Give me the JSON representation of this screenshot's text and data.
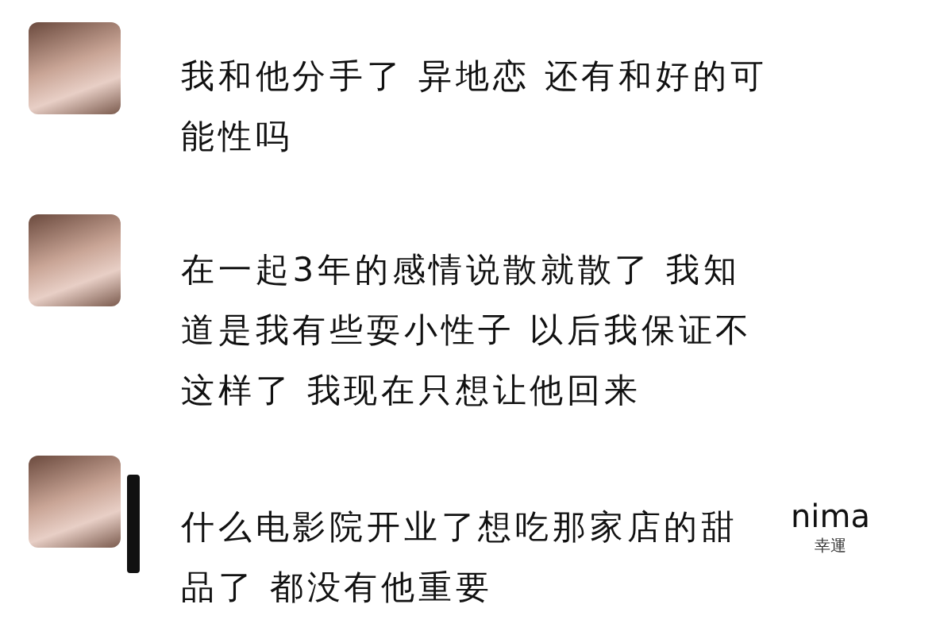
{
  "messages": [
    {
      "text": "我和他分手了 异地恋 还有和好的可能性吗",
      "marker": false
    },
    {
      "text": "在一起3年的感情说散就散了 我知道是我有些耍小性子 以后我保证不这样了 我现在只想让他回来",
      "marker": false
    },
    {
      "text": "什么电影院开业了想吃那家店的甜品了 都没有他重要",
      "marker": true
    }
  ],
  "sticker": {
    "title": "nima",
    "subtitle": "幸運"
  }
}
